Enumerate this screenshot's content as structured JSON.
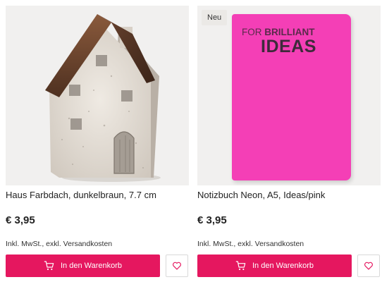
{
  "products": [
    {
      "title": "Haus Farbdach, dunkelbraun, 7.7 cm",
      "price": "€ 3,95",
      "tax_note": "Inkl. MwSt., exkl. Versandkosten",
      "cart_label": "In den Warenkorb",
      "image": "ceramic-house-figurine"
    },
    {
      "badge": "Neu",
      "title": "Notizbuch Neon, A5, Ideas/pink",
      "price": "€ 3,95",
      "tax_note": "Inkl. MwSt., exkl. Versandkosten",
      "cart_label": "In den Warenkorb",
      "image": "pink-notebook",
      "cover_text_a": "FOR ",
      "cover_text_b": "BRILLIANT",
      "cover_text_c": "IDEAS"
    }
  ],
  "colors": {
    "accent": "#e5175f",
    "notebook": "#f43fb6"
  },
  "icons": {
    "cart": "cart-icon",
    "wishlist": "heart-icon"
  }
}
